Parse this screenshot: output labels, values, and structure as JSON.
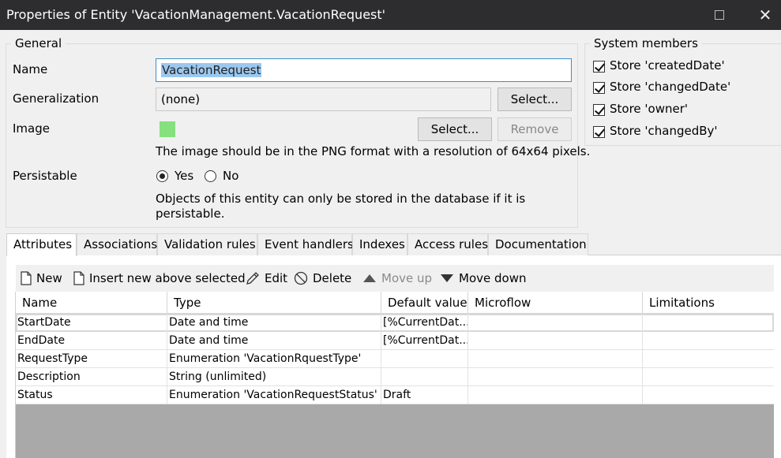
{
  "window": {
    "title": "Properties of Entity 'VacationManagement.VacationRequest'"
  },
  "general": {
    "legend": "General",
    "name_label": "Name",
    "name_value": "VacationRequest",
    "generalization_label": "Generalization",
    "generalization_value": "(none)",
    "generalization_select": "Select...",
    "image_label": "Image",
    "image_select": "Select...",
    "image_remove": "Remove",
    "image_hint": "The image should be in the PNG format with a resolution of 64x64 pixels.",
    "image_color": "#86e07e",
    "persistable_label": "Persistable",
    "yes_label": "Yes",
    "no_label": "No",
    "persistable_selected": "Yes",
    "persistable_hint_line1": "Objects of this entity can only be stored in the database if it is",
    "persistable_hint_line2": "persistable."
  },
  "system_members": {
    "legend": "System members",
    "items": [
      {
        "label": "Store 'createdDate'",
        "checked": true
      },
      {
        "label": "Store 'changedDate'",
        "checked": true
      },
      {
        "label": "Store 'owner'",
        "checked": true
      },
      {
        "label": "Store 'changedBy'",
        "checked": true
      }
    ]
  },
  "tabs": [
    {
      "label": "Attributes",
      "active": true
    },
    {
      "label": "Associations"
    },
    {
      "label": "Validation rules"
    },
    {
      "label": "Event handlers"
    },
    {
      "label": "Indexes"
    },
    {
      "label": "Access rules"
    },
    {
      "label": "Documentation"
    }
  ],
  "toolbar": {
    "new": "New",
    "insert": "Insert new above selected",
    "edit": "Edit",
    "delete": "Delete",
    "move_up": "Move up",
    "move_down": "Move down"
  },
  "grid": {
    "columns": [
      "Name",
      "Type",
      "Default value",
      "Microflow",
      "Limitations"
    ],
    "rows": [
      [
        "StartDate",
        "Date and time",
        "[%CurrentDat...",
        "",
        ""
      ],
      [
        "EndDate",
        "Date and time",
        "[%CurrentDat...",
        "",
        ""
      ],
      [
        "RequestType",
        "Enumeration 'VacationRquestType'",
        "",
        "",
        ""
      ],
      [
        "Description",
        "String (unlimited)",
        "",
        "",
        ""
      ],
      [
        "Status",
        "Enumeration 'VacationRequestStatus'",
        "Draft",
        "",
        ""
      ]
    ]
  }
}
